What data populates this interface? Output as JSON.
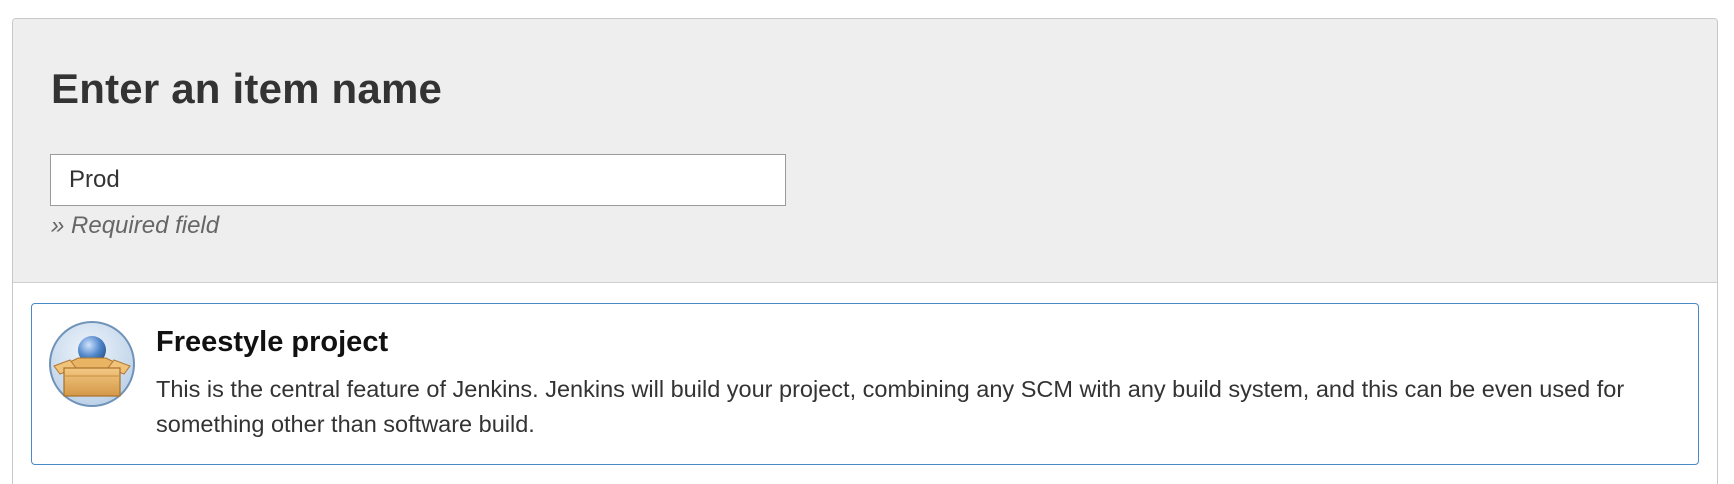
{
  "form": {
    "title": "Enter an item name",
    "item_name_value": "Prod",
    "required_hint": "» Required field"
  },
  "items": [
    {
      "icon": "freestyle-project-icon",
      "title": "Freestyle project",
      "description": "This is the central feature of Jenkins. Jenkins will build your project, combining any SCM with any build system, and this can be even used for something other than software build."
    }
  ],
  "colors": {
    "header_background": "#eeeeee",
    "selected_border": "#4a8ac6",
    "title_text": "#333333",
    "hint_text": "#666666"
  }
}
